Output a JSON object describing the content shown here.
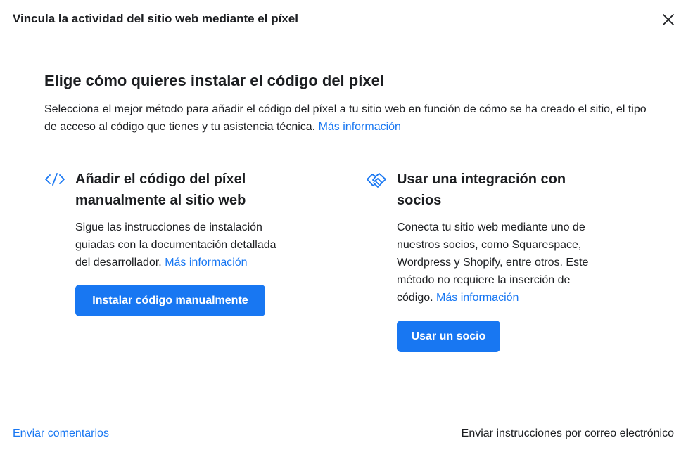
{
  "dialog": {
    "title": "Vincula la actividad del sitio web mediante el píxel",
    "close_icon": "close-icon"
  },
  "section": {
    "title": "Elige cómo quieres instalar el código del píxel",
    "description": "Selecciona el mejor método para añadir el código del píxel a tu sitio web en función de cómo se ha creado el sitio, el tipo de acceso al código que tienes y tu asistencia técnica.",
    "more_info": "Más información"
  },
  "options": {
    "manual": {
      "icon": "code-icon",
      "title": "Añadir el código del píxel manualmente al sitio web",
      "description": "Sigue las instrucciones de instalación guiadas con la documentación detallada del desarrollador.",
      "more_info": "Más información",
      "button_label": "Instalar código manualmente"
    },
    "partner": {
      "icon": "handshake-icon",
      "title": "Usar una integración con socios",
      "description": "Conecta tu sitio web mediante uno de nuestros socios, como Squarespace, Wordpress y Shopify, entre otros. Este método no requiere la inserción de código.",
      "more_info": "Más información",
      "button_label": "Usar un socio"
    }
  },
  "footer": {
    "feedback_link": "Enviar comentarios",
    "email_instructions": "Enviar instrucciones por correo electrónico"
  },
  "colors": {
    "accent": "#1877f2",
    "text": "#1c1e21",
    "background": "#ffffff"
  }
}
